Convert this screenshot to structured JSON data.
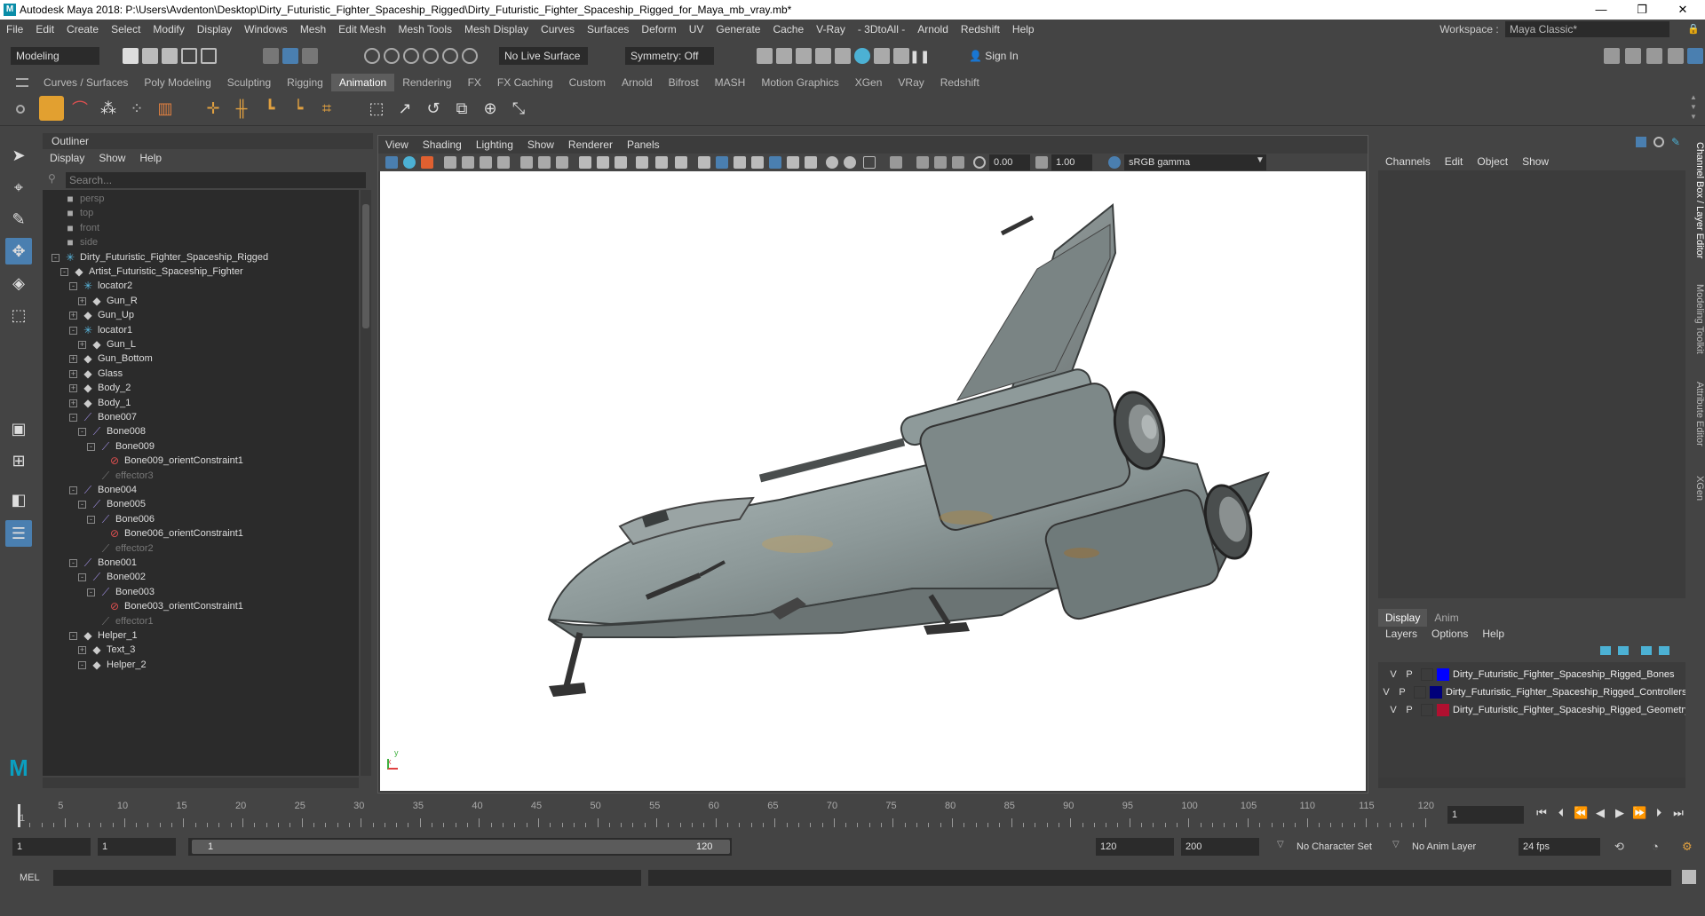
{
  "window": {
    "title": "Autodesk Maya 2018: P:\\Users\\Avdenton\\Desktop\\Dirty_Futuristic_Fighter_Spaceship_Rigged\\Dirty_Futuristic_Fighter_Spaceship_Rigged_for_Maya_mb_vray.mb*",
    "logo": "M",
    "minimize": "—",
    "maximize": "❐",
    "close": "✕"
  },
  "menubar": {
    "items": [
      "File",
      "Edit",
      "Create",
      "Select",
      "Modify",
      "Display",
      "Windows",
      "Mesh",
      "Edit Mesh",
      "Mesh Tools",
      "Mesh Display",
      "Curves",
      "Surfaces",
      "Deform",
      "UV",
      "Generate",
      "Cache",
      "V-Ray",
      "- 3DtoAll -",
      "Arnold",
      "Redshift",
      "Help"
    ],
    "workspace_label": "Workspace :",
    "workspace_value": "Maya Classic*"
  },
  "statusline": {
    "mode": "Modeling",
    "live_surface": "No Live Surface",
    "symmetry": "Symmetry: Off",
    "sign_in": "Sign In"
  },
  "shelf": {
    "tabs": [
      "Curves / Surfaces",
      "Poly Modeling",
      "Sculpting",
      "Rigging",
      "Animation",
      "Rendering",
      "FX",
      "FX Caching",
      "Custom",
      "Arnold",
      "Bifrost",
      "MASH",
      "Motion Graphics",
      "XGen",
      "VRay",
      "Redshift"
    ],
    "active_tab": "Animation"
  },
  "outliner": {
    "title": "Outliner",
    "menu": [
      "Display",
      "Show",
      "Help"
    ],
    "search_placeholder": "Search...",
    "rows": [
      {
        "label": "persp",
        "depth": 0,
        "icon": "camera-icon",
        "dim": true,
        "exp": ""
      },
      {
        "label": "top",
        "depth": 0,
        "icon": "camera-icon",
        "dim": true,
        "exp": ""
      },
      {
        "label": "front",
        "depth": 0,
        "icon": "camera-icon",
        "dim": true,
        "exp": ""
      },
      {
        "label": "side",
        "depth": 0,
        "icon": "camera-icon",
        "dim": true,
        "exp": ""
      },
      {
        "label": "Dirty_Futuristic_Fighter_Spaceship_Rigged",
        "depth": 0,
        "icon": "locator-icon",
        "dim": false,
        "exp": "-"
      },
      {
        "label": "Artist_Futuristic_Spaceship_Fighter",
        "depth": 1,
        "icon": "transform-icon",
        "dim": false,
        "exp": "-"
      },
      {
        "label": "locator2",
        "depth": 2,
        "icon": "locator-icon",
        "dim": false,
        "exp": "-"
      },
      {
        "label": "Gun_R",
        "depth": 3,
        "icon": "transform-icon",
        "dim": false,
        "exp": "+"
      },
      {
        "label": "Gun_Up",
        "depth": 2,
        "icon": "transform-icon",
        "dim": false,
        "exp": "+"
      },
      {
        "label": "locator1",
        "depth": 2,
        "icon": "locator-icon",
        "dim": false,
        "exp": "-"
      },
      {
        "label": "Gun_L",
        "depth": 3,
        "icon": "transform-icon",
        "dim": false,
        "exp": "+"
      },
      {
        "label": "Gun_Bottom",
        "depth": 2,
        "icon": "transform-icon",
        "dim": false,
        "exp": "+"
      },
      {
        "label": "Glass",
        "depth": 2,
        "icon": "transform-icon",
        "dim": false,
        "exp": "+"
      },
      {
        "label": "Body_2",
        "depth": 2,
        "icon": "transform-icon",
        "dim": false,
        "exp": "+"
      },
      {
        "label": "Body_1",
        "depth": 2,
        "icon": "transform-icon",
        "dim": false,
        "exp": "+"
      },
      {
        "label": "Bone007",
        "depth": 2,
        "icon": "joint-icon",
        "dim": false,
        "exp": "-"
      },
      {
        "label": "Bone008",
        "depth": 3,
        "icon": "joint-icon",
        "dim": false,
        "exp": "-"
      },
      {
        "label": "Bone009",
        "depth": 4,
        "icon": "joint-icon",
        "dim": false,
        "exp": "-"
      },
      {
        "label": "Bone009_orientConstraint1",
        "depth": 5,
        "icon": "constraint-icon",
        "dim": false,
        "exp": ""
      },
      {
        "label": "effector3",
        "depth": 4,
        "icon": "effector-icon",
        "dim": true,
        "exp": ""
      },
      {
        "label": "Bone004",
        "depth": 2,
        "icon": "joint-icon",
        "dim": false,
        "exp": "-"
      },
      {
        "label": "Bone005",
        "depth": 3,
        "icon": "joint-icon",
        "dim": false,
        "exp": "-"
      },
      {
        "label": "Bone006",
        "depth": 4,
        "icon": "joint-icon",
        "dim": false,
        "exp": "-"
      },
      {
        "label": "Bone006_orientConstraint1",
        "depth": 5,
        "icon": "constraint-icon",
        "dim": false,
        "exp": ""
      },
      {
        "label": "effector2",
        "depth": 4,
        "icon": "effector-icon",
        "dim": true,
        "exp": ""
      },
      {
        "label": "Bone001",
        "depth": 2,
        "icon": "joint-icon",
        "dim": false,
        "exp": "-"
      },
      {
        "label": "Bone002",
        "depth": 3,
        "icon": "joint-icon",
        "dim": false,
        "exp": "-"
      },
      {
        "label": "Bone003",
        "depth": 4,
        "icon": "joint-icon",
        "dim": false,
        "exp": "-"
      },
      {
        "label": "Bone003_orientConstraint1",
        "depth": 5,
        "icon": "constraint-icon",
        "dim": false,
        "exp": ""
      },
      {
        "label": "effector1",
        "depth": 4,
        "icon": "effector-icon",
        "dim": true,
        "exp": ""
      },
      {
        "label": "Helper_1",
        "depth": 2,
        "icon": "transform-icon",
        "dim": false,
        "exp": "-"
      },
      {
        "label": "Text_3",
        "depth": 3,
        "icon": "transform-icon",
        "dim": false,
        "exp": "+"
      },
      {
        "label": "Helper_2",
        "depth": 3,
        "icon": "transform-icon",
        "dim": false,
        "exp": "-"
      }
    ]
  },
  "viewport": {
    "menu": [
      "View",
      "Shading",
      "Lighting",
      "Show",
      "Renderer",
      "Panels"
    ],
    "exposure": "0.00",
    "gamma": "1.00",
    "color_space": "sRGB gamma",
    "axis_x": "x",
    "axis_y": "y"
  },
  "channel_box": {
    "menu": [
      "Channels",
      "Edit",
      "Object",
      "Show"
    ],
    "side_tabs": [
      "Channel Box / Layer Editor",
      "Modeling Toolkit",
      "Attribute Editor",
      "XGen"
    ]
  },
  "layer_editor": {
    "tabs": [
      "Display",
      "Anim"
    ],
    "active_tab": "Display",
    "menu": [
      "Layers",
      "Options",
      "Help"
    ],
    "layers": [
      {
        "v": "V",
        "p": "P",
        "color": "#0000ff",
        "name": "Dirty_Futuristic_Fighter_Spaceship_Rigged_Bones"
      },
      {
        "v": "V",
        "p": "P",
        "color": "#00007a",
        "name": "Dirty_Futuristic_Fighter_Spaceship_Rigged_Controllers"
      },
      {
        "v": "V",
        "p": "P",
        "color": "#b01030",
        "name": "Dirty_Futuristic_Fighter_Spaceship_Rigged_Geometry"
      }
    ]
  },
  "timeline": {
    "ticks": [
      "5",
      "10",
      "15",
      "20",
      "25",
      "30",
      "35",
      "40",
      "45",
      "50",
      "55",
      "60",
      "65",
      "70",
      "75",
      "80",
      "85",
      "90",
      "95",
      "100",
      "105",
      "110",
      "115",
      "120"
    ],
    "first_tick": "1",
    "current_frame": "1",
    "range_start": "1",
    "anim_start": "1",
    "range_slider_start": "1",
    "range_slider_end": "120",
    "range_end": "120",
    "anim_end": "200",
    "character_set": "No Character Set",
    "anim_layer": "No Anim Layer",
    "fps": "24 fps"
  },
  "command_line": {
    "language": "MEL"
  }
}
